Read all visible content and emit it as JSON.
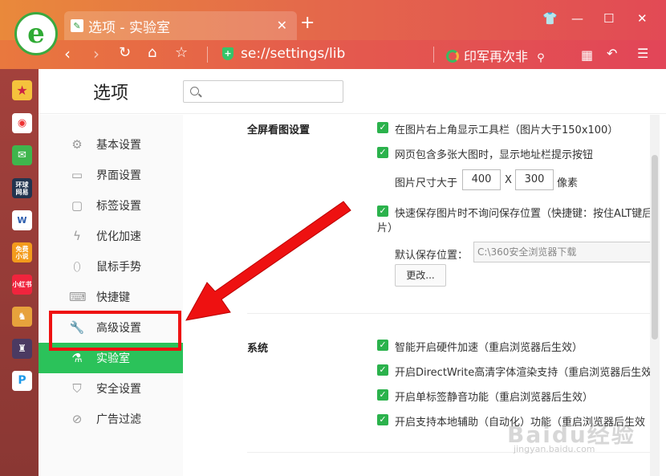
{
  "titlebar": {
    "tab_title": "选项 - 实验室",
    "new_tab": "+",
    "close_tab": "✕"
  },
  "addressbar": {
    "url": "se://settings/lib",
    "search_text": "印军再次非",
    "search_icon": "magnifier-icon"
  },
  "header": {
    "title": "选项",
    "search_placeholder": ""
  },
  "sidebar": {
    "items": [
      {
        "label": "基本设置",
        "icon": "gear-icon"
      },
      {
        "label": "界面设置",
        "icon": "window-icon"
      },
      {
        "label": "标签设置",
        "icon": "tab-icon"
      },
      {
        "label": "优化加速",
        "icon": "lightning-icon"
      },
      {
        "label": "鼠标手势",
        "icon": "mouse-icon"
      },
      {
        "label": "快捷键",
        "icon": "keyboard-icon"
      },
      {
        "label": "高级设置",
        "icon": "wrench-icon"
      },
      {
        "label": "实验室",
        "icon": "flask-icon",
        "active": true
      },
      {
        "label": "安全设置",
        "icon": "shield-icon"
      },
      {
        "label": "广告过滤",
        "icon": "block-icon"
      }
    ]
  },
  "sections": {
    "fullscreen": {
      "title": "全屏看图设置",
      "opt1": "在图片右上角显示工具栏（图片大于150x100）",
      "opt2": "网页包含多张大图时，显示地址栏提示按钮",
      "size_prefix": "图片尺寸大于",
      "size_w": "400",
      "size_x": "X",
      "size_h": "300",
      "size_unit": "像素",
      "opt3_line1": "快速保存图片时不询问保存位置（快捷键：按住ALT键后",
      "opt3_line2": "片）",
      "save_label": "默认保存位置：",
      "save_path": "C:\\360安全浏览器下载",
      "change_btn": "更改..."
    },
    "system": {
      "title": "系统",
      "opt1": "智能开启硬件加速（重启浏览器后生效）",
      "opt2": "开启DirectWrite高清字体渲染支持（重启浏览器后生效",
      "opt3": "开启单标签静音功能（重启浏览器后生效）",
      "opt4": "开启支持本地辅助（自动化）功能（重启浏览器后生效"
    }
  },
  "watermark": {
    "brand": "Baidu经验",
    "site": "jingyan.baidu.com"
  },
  "colors": {
    "accent_green": "#2bc25a",
    "highlight_red": "#e11111",
    "titlebar_start": "#e9893b",
    "titlebar_end": "#e24a55"
  }
}
